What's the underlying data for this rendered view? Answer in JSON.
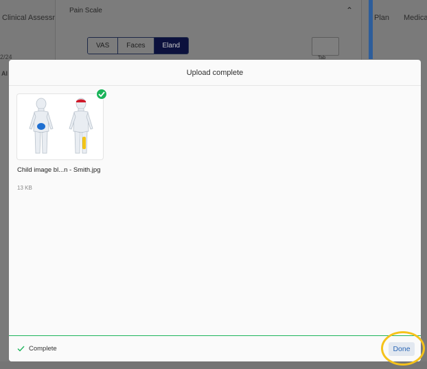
{
  "background": {
    "tabs": [
      "Clinical Assessm",
      "Plan",
      "Medica"
    ],
    "left_fragment": "2/24",
    "left_fragment2": "Al",
    "panel_title": "Pain Scale",
    "segments": [
      "VAS",
      "Faces",
      "Eland"
    ],
    "active_segment": "Eland",
    "box_caption": "Tab"
  },
  "modal": {
    "title": "Upload complete",
    "file": {
      "name": "Child image bl...n - Smith.jpg",
      "size": "13 KB",
      "uploaded": true
    },
    "footer": {
      "status_icon": "check-icon",
      "status_text": "Complete",
      "done_label": "Done"
    }
  },
  "colors": {
    "success": "#1bb45a",
    "primary_text": "#2a66b5",
    "highlight": "#f5c21b",
    "active_segment_bg": "#0c113d"
  }
}
